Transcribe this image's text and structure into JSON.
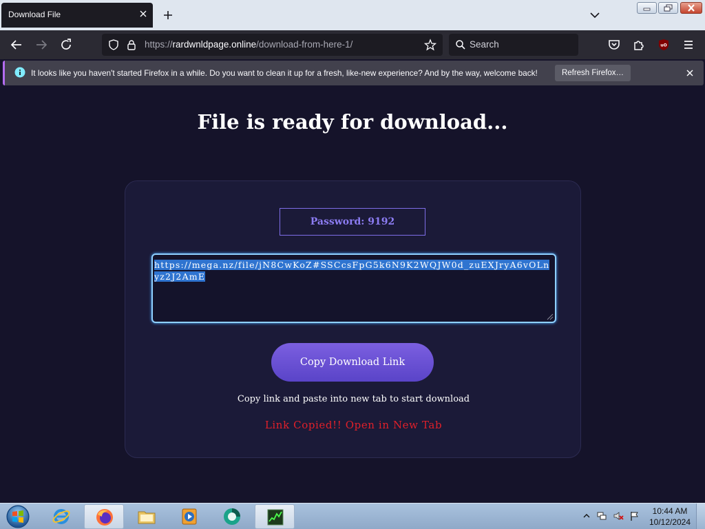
{
  "browser": {
    "tab": {
      "title": "Download File"
    },
    "url": {
      "prefix": "https://",
      "domain": "rardwnldpage.online",
      "path": "/download-from-here-1/"
    },
    "search": {
      "placeholder": "Search"
    },
    "notification": {
      "message": "It looks like you haven't started Firefox in a while. Do you want to clean it up for a fresh, like-new experience? And by the way, welcome back!",
      "button_label": "Refresh Firefox…"
    }
  },
  "page": {
    "title": "File is ready for download...",
    "password_label": "Password: 9192",
    "download_link": "https://mega.nz/file/jN8CwKoZ#SSCcsFpG5k6N9K2WQJW0d_zuEXJryA6vOLnyz2J2AmE",
    "copy_button_label": "Copy Download Link",
    "instruction": "Copy link and paste into new tab to start download",
    "copied_message": "Link Copied!! Open in New Tab"
  },
  "taskbar": {
    "clock_time": "10:44 AM",
    "clock_date": "10/12/2024",
    "pinned": [
      "internet-explorer-icon",
      "firefox-icon",
      "file-explorer-icon",
      "media-player-icon",
      "app-icon",
      "task-manager-icon"
    ]
  },
  "colors": {
    "page_background": "#15132a",
    "accent_purple": "#6a52d8",
    "copied_red": "#e0202a",
    "selection_blue": "#2f74d0"
  }
}
